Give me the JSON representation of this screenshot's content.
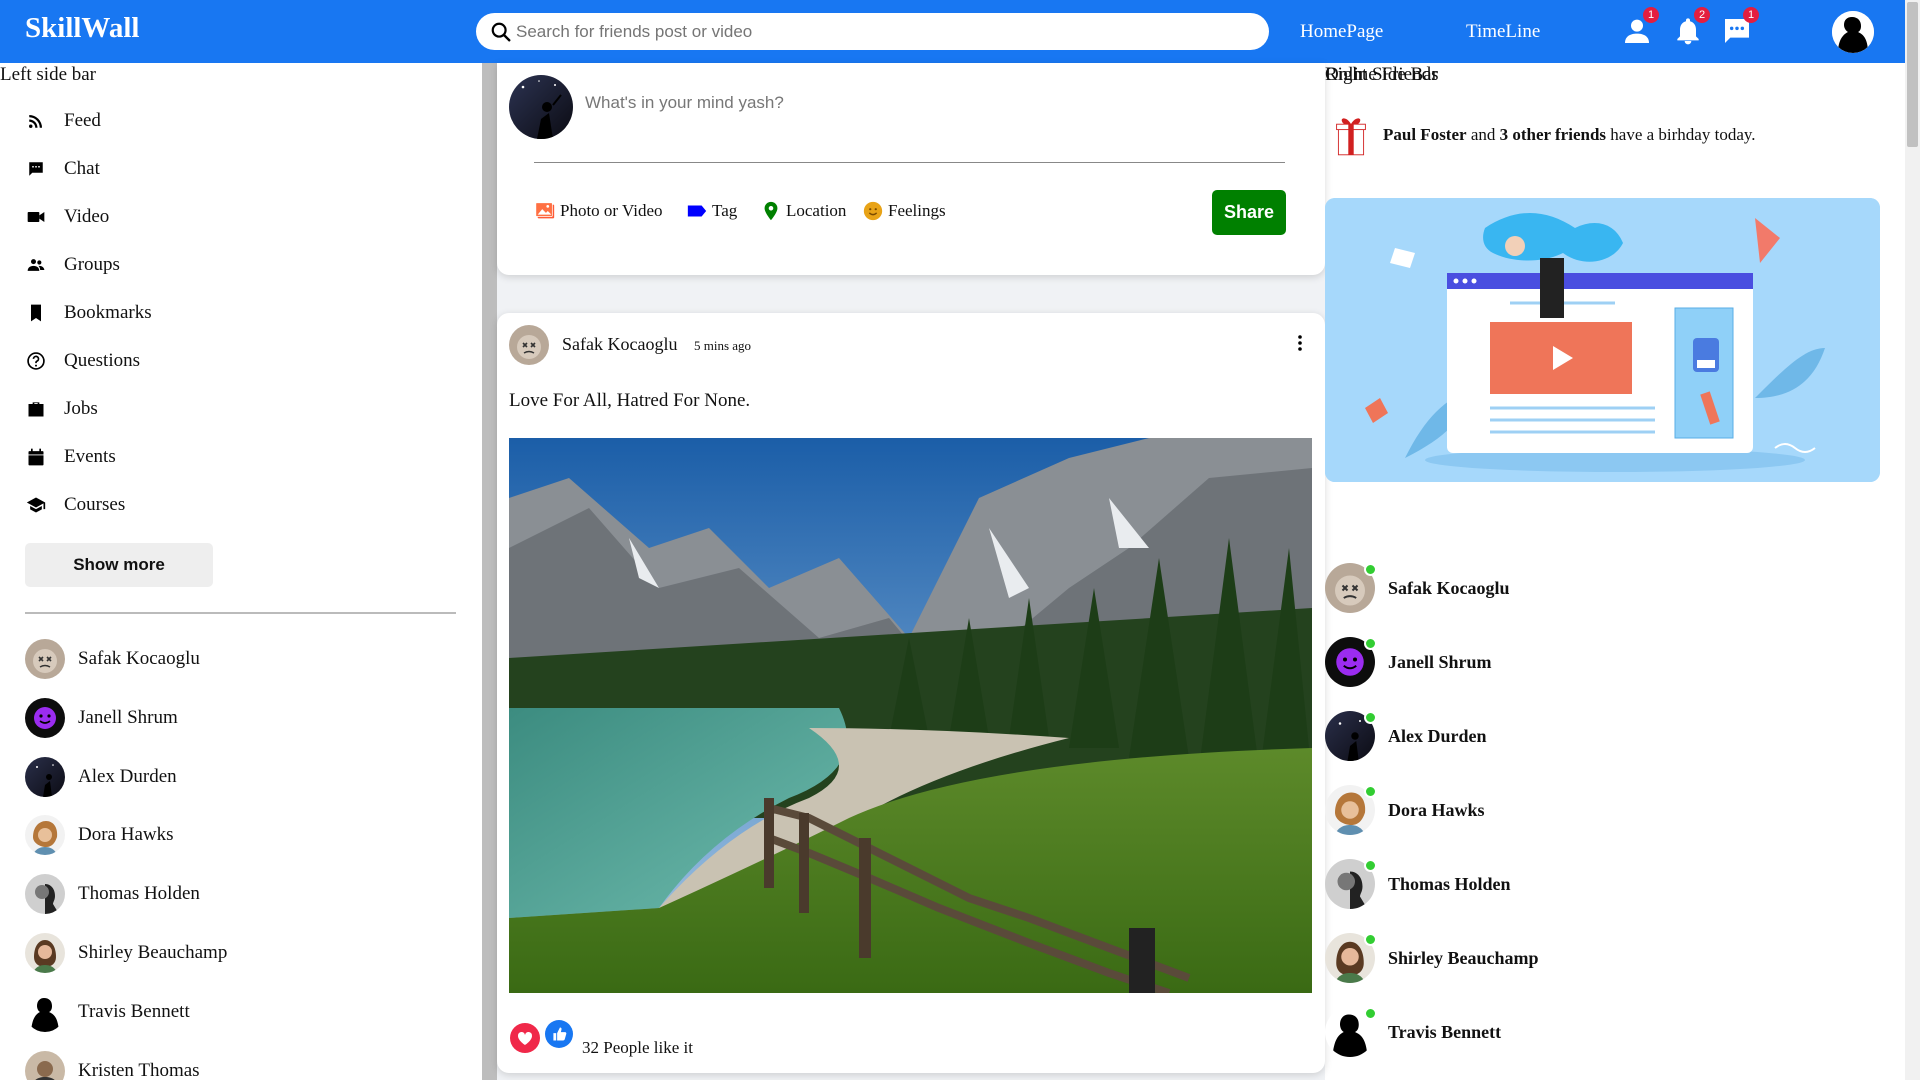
{
  "app": {
    "logo": "SkillWall"
  },
  "topbar": {
    "search_placeholder": "Search for friends post or video",
    "nav": [
      "HomePage",
      "TimeLine"
    ],
    "badges": {
      "friends": "1",
      "notifications": "2",
      "messages": "1"
    },
    "brand_color": "#1877f2"
  },
  "left": {
    "title": "Left side bar",
    "menu": [
      {
        "label": "Feed",
        "icon": "rss-icon"
      },
      {
        "label": "Chat",
        "icon": "chat-icon"
      },
      {
        "label": "Video",
        "icon": "video-icon"
      },
      {
        "label": "Groups",
        "icon": "groups-icon"
      },
      {
        "label": "Bookmarks",
        "icon": "bookmark-icon"
      },
      {
        "label": "Questions",
        "icon": "help-icon"
      },
      {
        "label": "Jobs",
        "icon": "work-icon"
      },
      {
        "label": "Events",
        "icon": "event-icon"
      },
      {
        "label": "Courses",
        "icon": "school-icon"
      }
    ],
    "show_more": "Show more",
    "friends": [
      "Safak Kocaoglu",
      "Janell Shrum",
      "Alex Durden",
      "Dora Hawks",
      "Thomas Holden",
      "Shirley Beauchamp",
      "Travis Bennett",
      "Kristen Thomas"
    ]
  },
  "share": {
    "placeholder": "What's in your mind yash?",
    "options": [
      "Photo or Video",
      "Tag",
      "Location",
      "Feelings"
    ],
    "button": "Share"
  },
  "post": {
    "author": "Safak Kocaoglu",
    "time": "5 mins ago",
    "text": "Love For All, Hatred For None.",
    "likes": "32 People like it"
  },
  "right": {
    "title": "Right Side Bar",
    "birthday": {
      "name": "Paul Foster",
      "and": "and",
      "others": "3 other friends",
      "rest": "have a birhday today."
    },
    "online_title": "Online Friends",
    "online": [
      "Safak Kocaoglu",
      "Janell Shrum",
      "Alex Durden",
      "Dora Hawks",
      "Thomas Holden",
      "Shirley Beauchamp",
      "Travis Bennett"
    ]
  }
}
